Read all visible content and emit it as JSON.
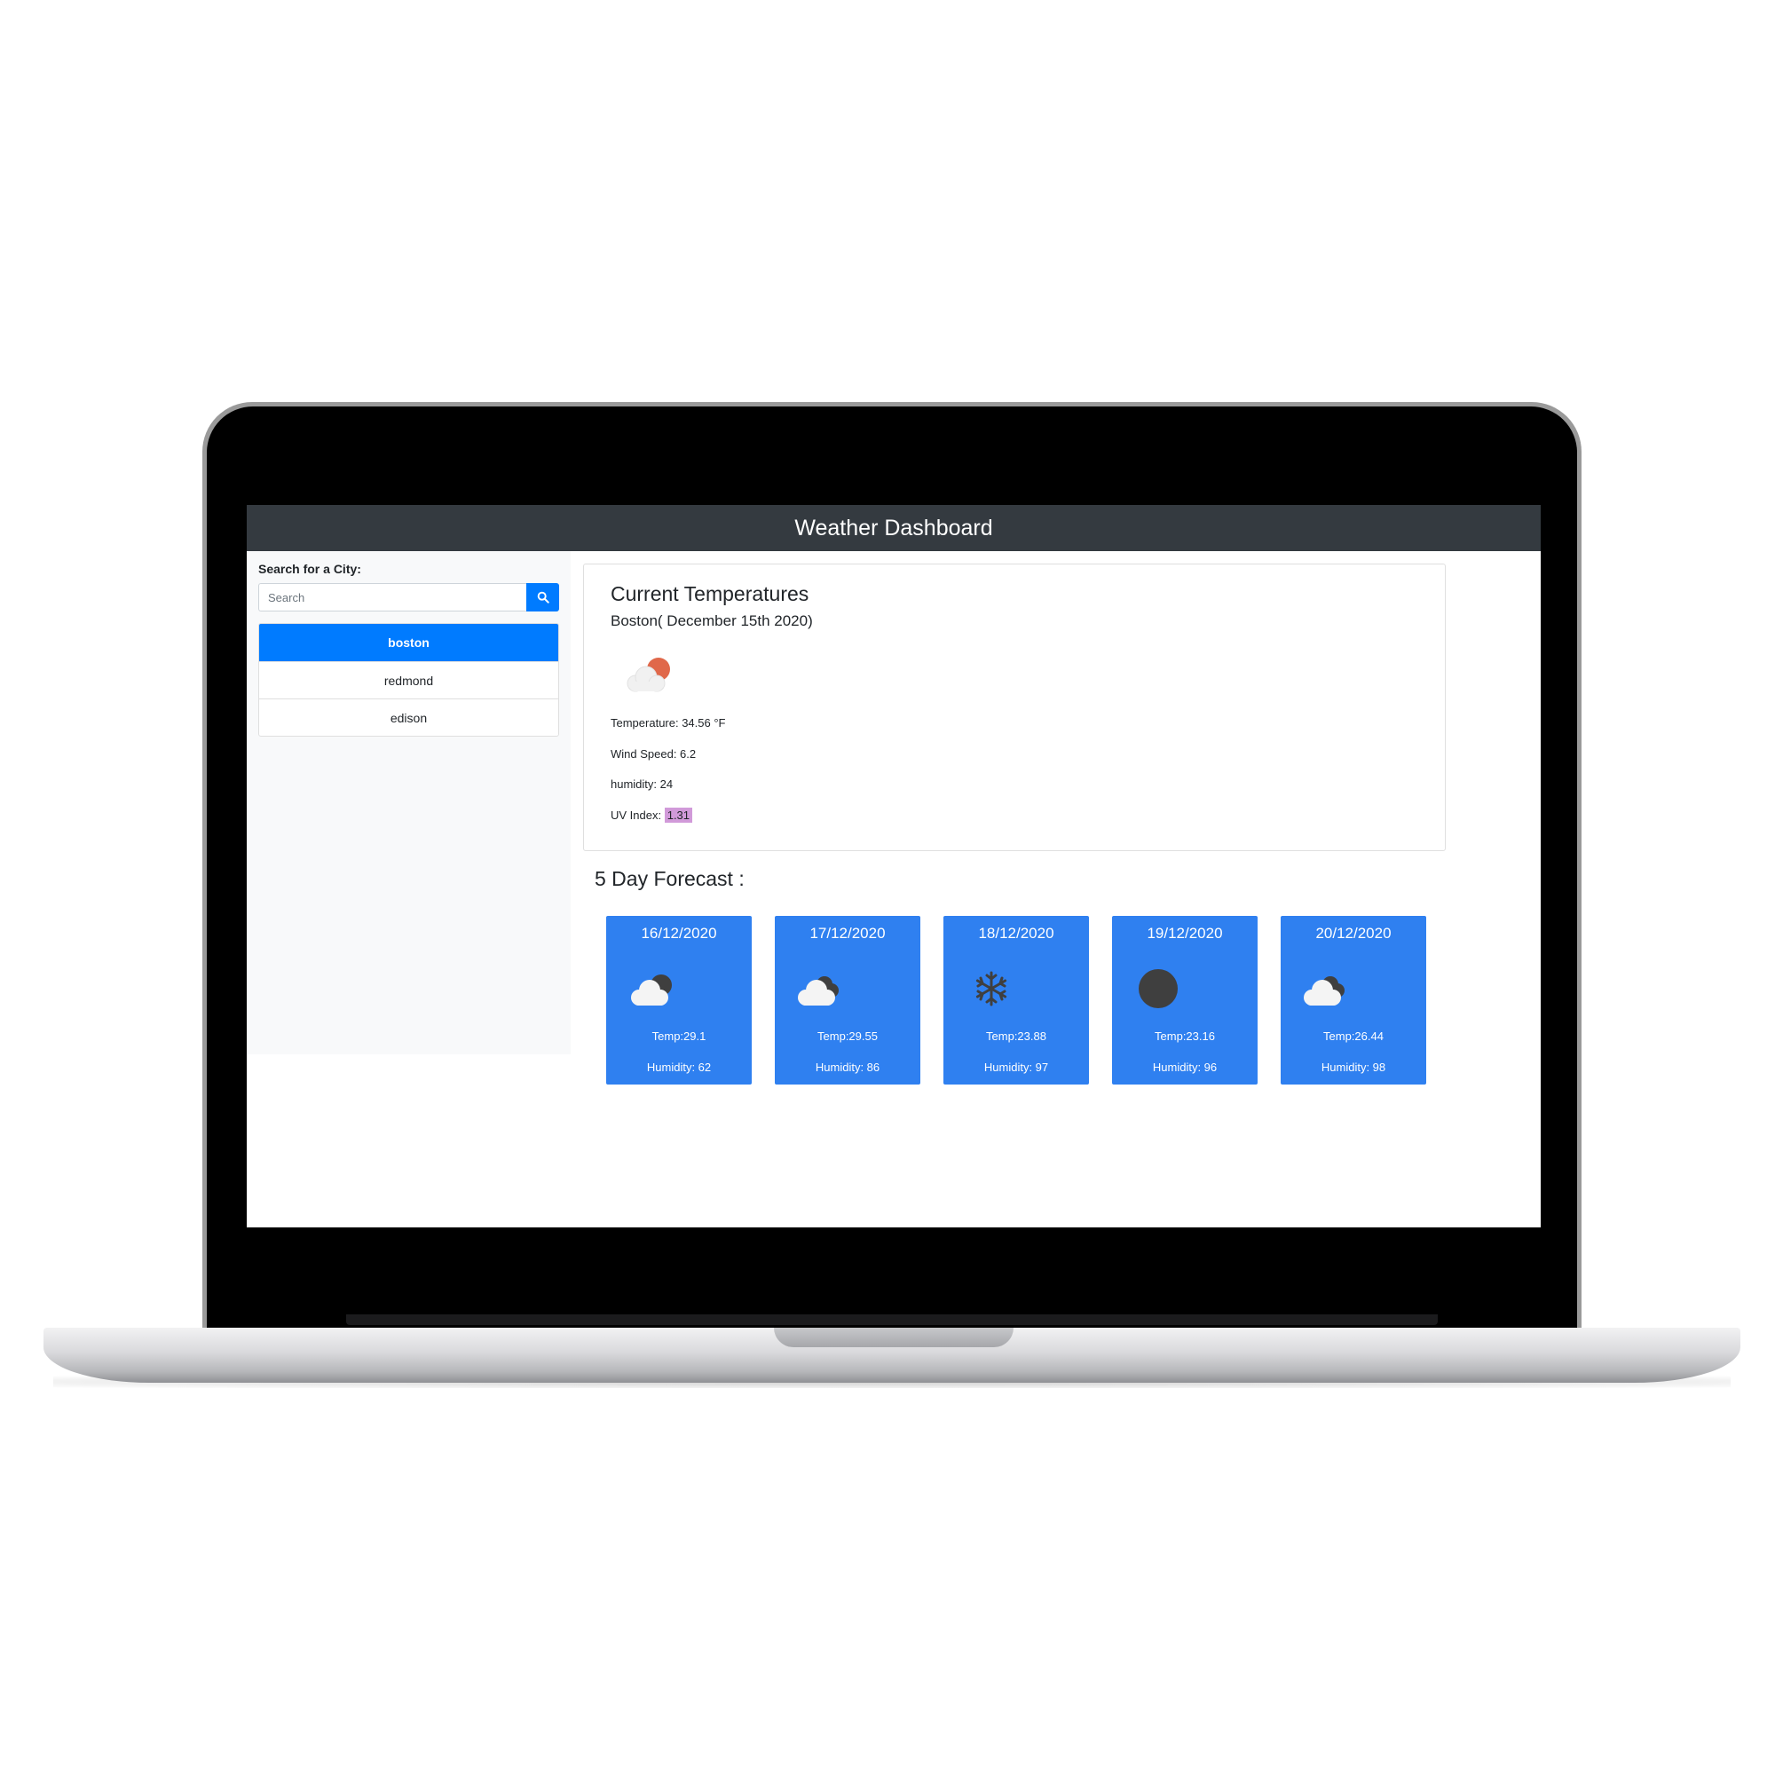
{
  "app": {
    "title": "Weather Dashboard"
  },
  "search": {
    "label": "Search for a City:",
    "placeholder": "Search",
    "value": "",
    "icon": "search-icon"
  },
  "cities": [
    {
      "name": "boston",
      "active": true
    },
    {
      "name": "redmond",
      "active": false
    },
    {
      "name": "edison",
      "active": false
    }
  ],
  "current": {
    "title": "Current Temperatures",
    "city_date": "Boston( December 15th 2020)",
    "icon": "partly-cloudy-day-icon",
    "temperature": "Temperature: 34.56 °F",
    "wind": "Wind Speed: 6.2",
    "humidity": "humidity: 24",
    "uv_label": "UV Index:",
    "uv_value": "1.31"
  },
  "forecast": {
    "title": "5 Day Forecast :",
    "days": [
      {
        "date": "16/12/2020",
        "icon": "partly-cloudy-night-icon",
        "temp": "Temp:29.1",
        "humidity": "Humidity: 62"
      },
      {
        "date": "17/12/2020",
        "icon": "cloudy-night-icon",
        "temp": "Temp:29.55",
        "humidity": "Humidity: 86"
      },
      {
        "date": "18/12/2020",
        "icon": "snow-icon",
        "temp": "Temp:23.88",
        "humidity": "Humidity: 97"
      },
      {
        "date": "19/12/2020",
        "icon": "clear-night-icon",
        "temp": "Temp:23.16",
        "humidity": "Humidity: 96"
      },
      {
        "date": "20/12/2020",
        "icon": "cloudy-night-icon",
        "temp": "Temp:26.44",
        "humidity": "Humidity: 98"
      }
    ]
  },
  "colors": {
    "navbar": "#343a40",
    "primary": "#007bff",
    "forecast_card": "#2f80f0",
    "uv_badge": "#d19ad9",
    "sidebar": "#f8f9fa"
  }
}
